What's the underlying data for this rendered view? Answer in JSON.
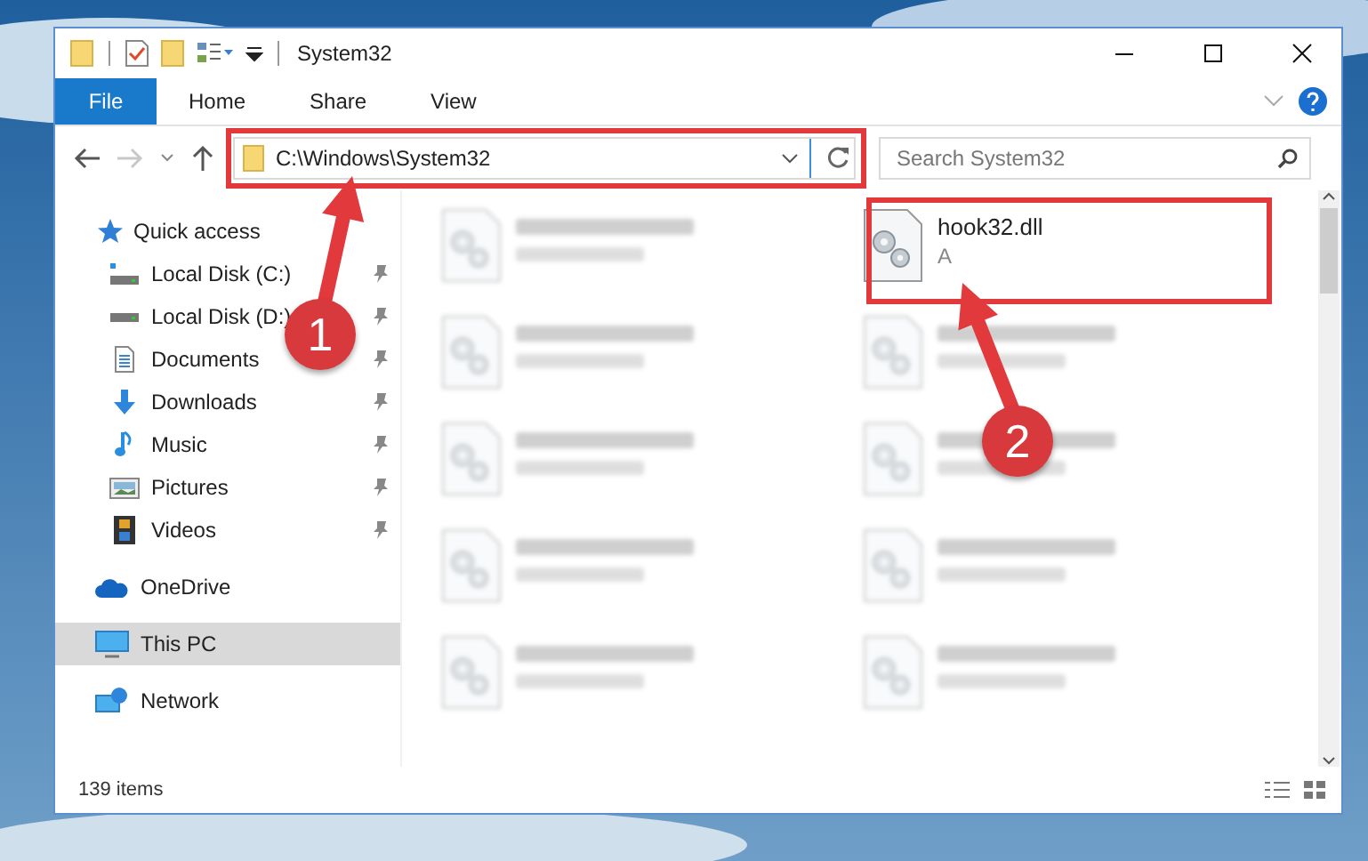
{
  "window": {
    "title": "System32"
  },
  "ribbon_tabs": [
    {
      "label": "File",
      "kind": "menu"
    },
    {
      "label": "Home",
      "kind": "tab"
    },
    {
      "label": "Share",
      "kind": "tab"
    },
    {
      "label": "View",
      "kind": "tab"
    }
  ],
  "address_bar": {
    "path": "C:\\Windows\\System32"
  },
  "search": {
    "placeholder": "Search System32"
  },
  "navigation": [
    {
      "label": "Quick access",
      "kind": "quick",
      "selected": false,
      "children": [
        {
          "label": "Local Disk (C:)",
          "kind": "system-drive",
          "pinned": true,
          "selected": false
        },
        {
          "label": "Local Disk (D:)",
          "kind": "drive",
          "pinned": true,
          "selected": false
        },
        {
          "label": "Documents",
          "kind": "documents",
          "pinned": true,
          "selected": false
        },
        {
          "label": "Downloads",
          "kind": "downloads",
          "pinned": true,
          "selected": false
        },
        {
          "label": "Music",
          "kind": "music",
          "pinned": true,
          "selected": false
        },
        {
          "label": "Pictures",
          "kind": "pictures",
          "pinned": true,
          "selected": false
        },
        {
          "label": "Videos",
          "kind": "videos",
          "pinned": true,
          "selected": false
        }
      ]
    },
    {
      "label": "OneDrive",
      "kind": "cloud",
      "selected": false
    },
    {
      "label": "This PC",
      "kind": "pc",
      "selected": true
    },
    {
      "label": "Network",
      "kind": "network",
      "selected": false
    }
  ],
  "files": [
    {
      "blurred": true
    },
    {
      "name": "hook32.dll",
      "type": "A",
      "blurred": false
    },
    {
      "blurred": true
    },
    {
      "blurred": true
    },
    {
      "blurred": true
    },
    {
      "blurred": true
    },
    {
      "blurred": true
    },
    {
      "blurred": true
    },
    {
      "blurred": true
    },
    {
      "blurred": true
    }
  ],
  "status_bar": {
    "item_count": "139 items"
  },
  "annotations": [
    {
      "label": "1"
    },
    {
      "label": "2"
    }
  ]
}
